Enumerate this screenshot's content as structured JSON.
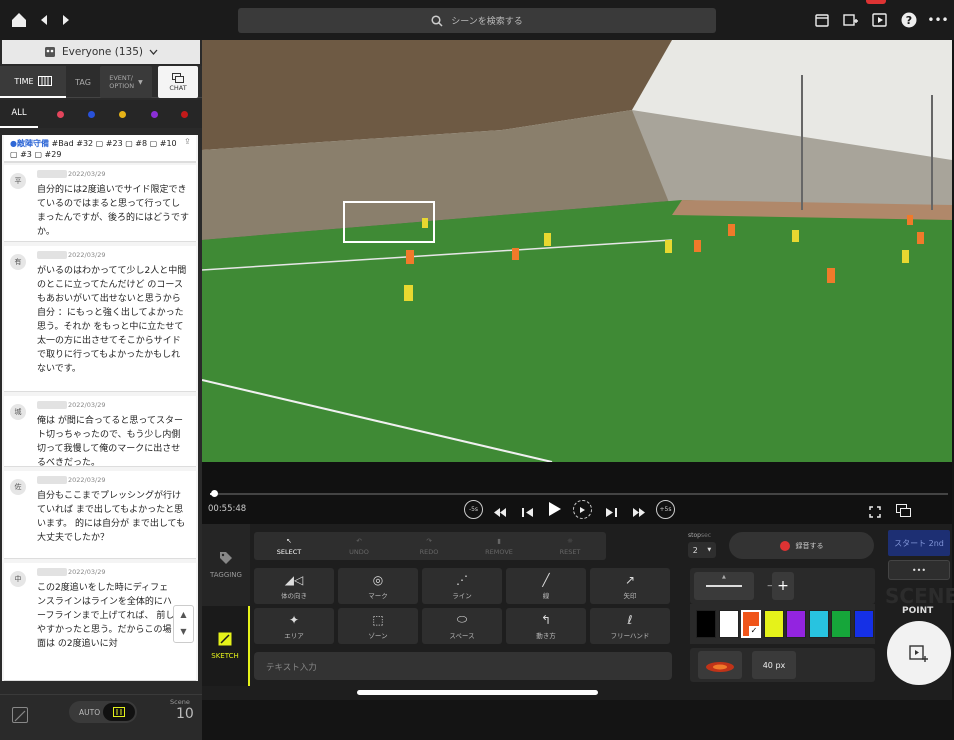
{
  "top": {
    "search_placeholder": "シーンを検索する"
  },
  "audience": "Everyone (135)",
  "tabs": {
    "time": "TIME",
    "tag": "TAG",
    "event": "EVENT/\nOPTION",
    "chat": "CHAT"
  },
  "filter_all": "ALL",
  "head_card": {
    "title": "●敵陣守備",
    "tags": "#Bad #32 ▢ #23 ▢ #8 ▢ #10 ▢ #3 ▢ #29"
  },
  "cards": [
    {
      "initial": "平",
      "date": "2022/03/29",
      "text": "自分的には2度追いでサイド限定できているのではまると思って行ってしまったんですが、後ろ的にはどうですか。"
    },
    {
      "initial": "有",
      "date": "2022/03/29",
      "text": "      がいるのはわかってて少し2人と中間のとこに立ってたんだけど     のコースもあおいがいて出せないと思うから自分     ：にもっと強く出してよかった思う。それか  をもっと中に立たせて太一の方に出させてそこからサイドで取りに行ってもよかったかもしれないです。"
    },
    {
      "initial": "城",
      "date": "2022/03/29",
      "text": "俺は  が間に合ってると思ってスタート切っちゃったので、もう少し内側切って我慢して俺のマークに出させるべきだった。"
    },
    {
      "initial": "佐",
      "date": "2022/03/29",
      "text": "自分もここまでプレッシングが行けていれば      まで出してもよかったと思います。     的には自分が       まで出しても大丈夫でしたか？"
    },
    {
      "initial": "中",
      "date": "2022/03/29",
      "text": "この2度追いをした時にディフェンスラインはラインを全体的にハーフラインまで上げてれば、    前しやすかったと思う。だからこの場面は  の2度追いに対"
    }
  ],
  "left_bottom": {
    "auto": "AUTO",
    "scene_label": "Scene",
    "scene_count": "10"
  },
  "video": {
    "time": "00:55:48",
    "progress": 0.006,
    "skip_back": "-5s",
    "skip_fwd": "+5s"
  },
  "tools": {
    "select": "SELECT",
    "undo": "UNDO",
    "redo": "REDO",
    "remove": "REMOVE",
    "reset": "RESET"
  },
  "shapes": [
    [
      "体の向き",
      "マーク",
      "ライン",
      "線",
      "矢印"
    ],
    [
      "エリア",
      "ゾーン",
      "スペース",
      "動き方",
      "フリーハンド"
    ]
  ],
  "side": {
    "tagging": "TAGGING",
    "sketch": "SKETCH"
  },
  "text_input_placeholder": "テキスト入力",
  "stop": {
    "label": "stop",
    "unit": "sec",
    "value": "2"
  },
  "record_label": "録音する",
  "start_label": "スタート 2nd",
  "more_label": "•••",
  "point_label": "POINT",
  "scene_watermark": "SCENE",
  "size_label": "40 px",
  "colors": [
    "#000000",
    "#ffffff",
    "#f0551a",
    "#e5f21a",
    "#9324e0",
    "#28c3e0",
    "#16a63a",
    "#1530e6"
  ],
  "selected_color": 2
}
